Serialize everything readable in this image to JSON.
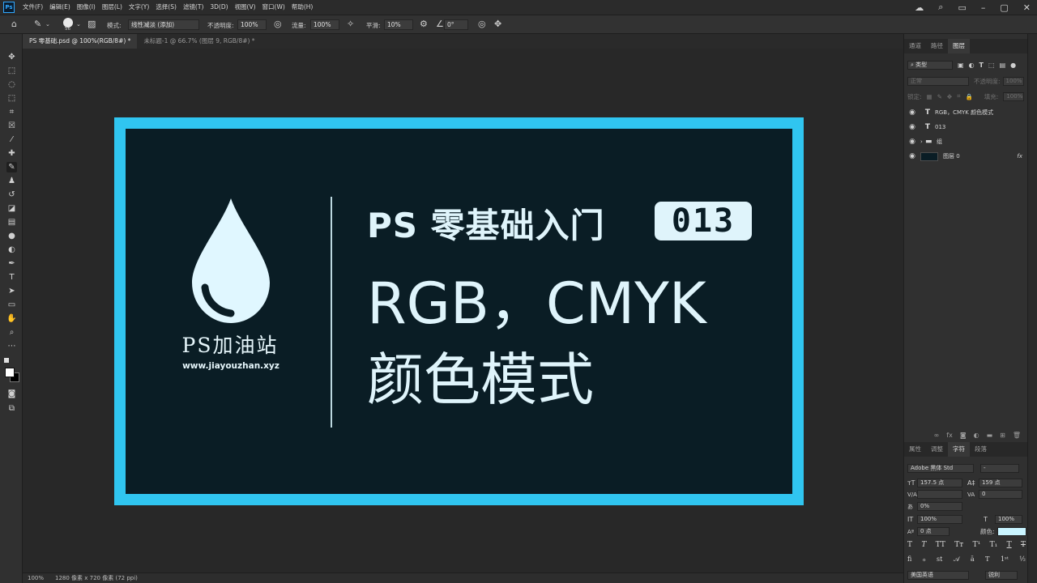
{
  "menu": {
    "logo": "Ps",
    "items": [
      "文件(F)",
      "编辑(E)",
      "图像(I)",
      "图层(L)",
      "文字(Y)",
      "选择(S)",
      "滤镜(T)",
      "3D(D)",
      "视图(V)",
      "窗口(W)",
      "帮助(H)"
    ]
  },
  "options": {
    "brush_size": "56",
    "mode_label": "模式:",
    "mode_value": "线性减淡 (添加)",
    "opacity_label": "不透明度:",
    "opacity_value": "100%",
    "flow_label": "流量:",
    "flow_value": "100%",
    "smooth_label": "平滑:",
    "smooth_value": "10%",
    "angle_value": "0°"
  },
  "tabs": {
    "active": "PS 零基础.psd @ 100%(RGB/8#) *",
    "inactive": "未标题-1 @ 66.7% (图层 9, RGB/8#) *"
  },
  "artboard": {
    "logo_text": "PS加油站",
    "logo_url": "www.jiayouzhan.xyz",
    "title_line1": "PS 零基础入门",
    "badge": "013",
    "title_line2": "RGB，CMYK",
    "title_line3": "颜色模式"
  },
  "status": {
    "zoom": "100%",
    "doc_size": "1280 像素 x 720 像素 (72 ppi)"
  },
  "layers_panel": {
    "tabs": [
      "通道",
      "路径",
      "图层"
    ],
    "filter_label": "类型",
    "blend_mode": "正常",
    "opacity_label": "不透明度:",
    "opacity_value": "100%",
    "lock_label": "锁定:",
    "fill_label": "填充:",
    "fill_value": "100%",
    "layers": [
      {
        "name": "RGB，CMYK 颜色模式",
        "type": "T"
      },
      {
        "name": "013",
        "type": "T"
      },
      {
        "name": "组",
        "type": "folder"
      },
      {
        "name": "图层 0",
        "type": "image",
        "fx": "fx"
      }
    ]
  },
  "char_panel": {
    "tabs": [
      "属性",
      "调整",
      "字符",
      "段落"
    ],
    "font_family": "Adobe 黑体 Std",
    "font_style": "-",
    "font_size": "157.5 点",
    "leading": "159 点",
    "kerning": "",
    "tracking": "0",
    "scale_pct": "0%",
    "vert_scale": "100%",
    "horiz_scale": "100%",
    "baseline": "0 点",
    "color_label": "颜色:",
    "color": "#c9f4ff",
    "language": "美国英语",
    "antialias": "锐利"
  }
}
